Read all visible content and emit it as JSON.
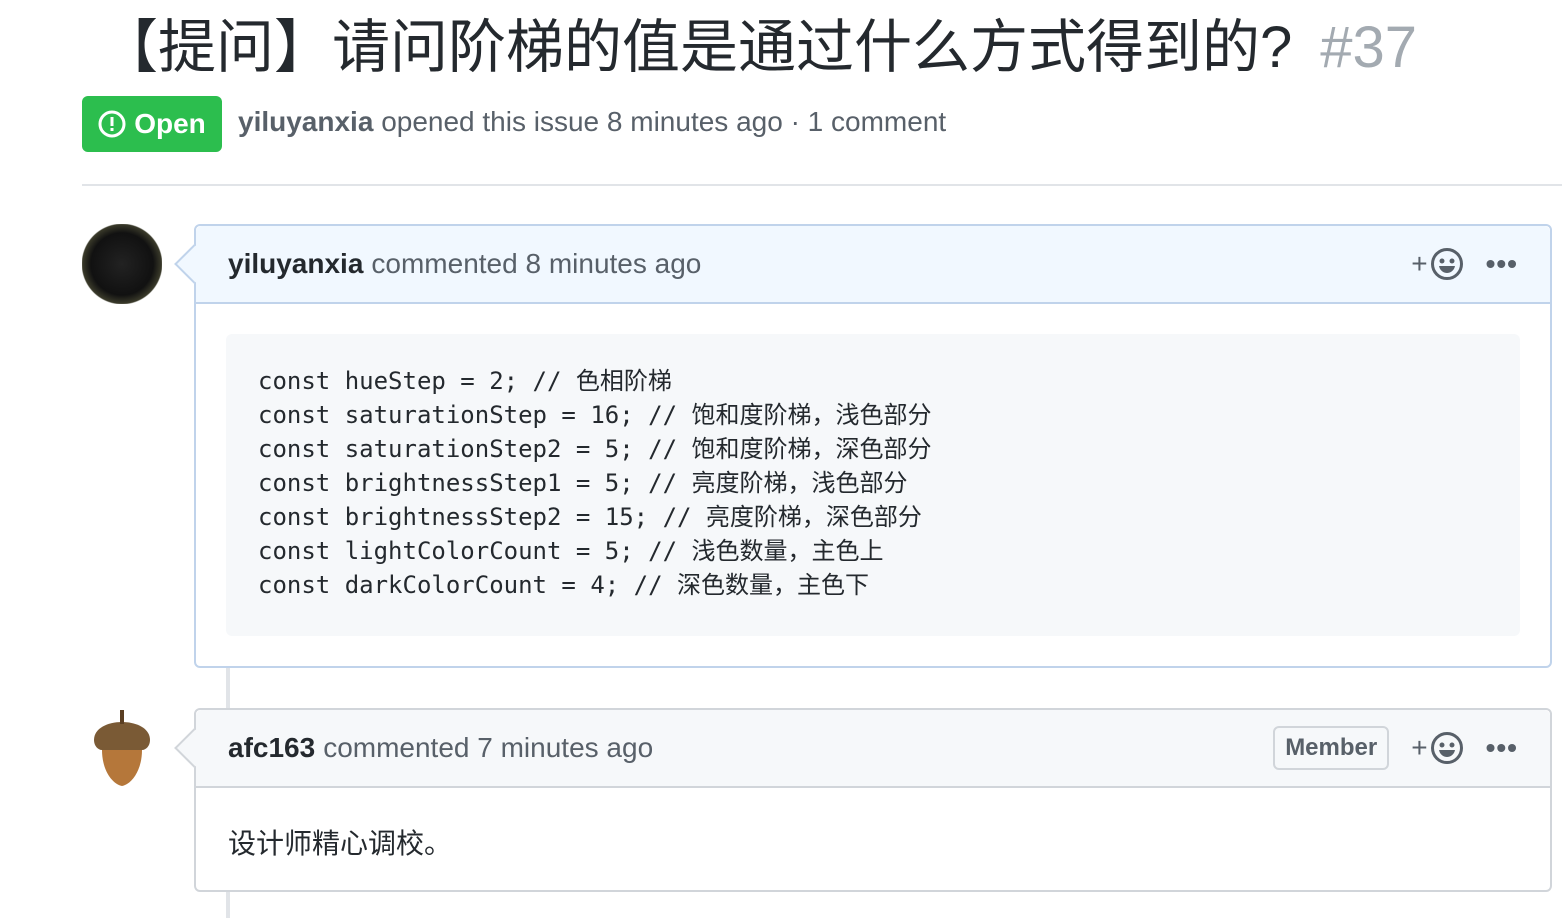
{
  "issue": {
    "title": "【提问】请问阶梯的值是通过什么方式得到的?",
    "number": "#37",
    "state": "Open",
    "author": "yiluyanxia",
    "meta_text": "opened this issue 8 minutes ago · 1 comment"
  },
  "comments": [
    {
      "author": "yiluyanxia",
      "action": "commented 8 minutes ago",
      "code": [
        "const hueStep = 2; // 色相阶梯",
        "const saturationStep = 16; // 饱和度阶梯，浅色部分",
        "const saturationStep2 = 5; // 饱和度阶梯，深色部分",
        "const brightnessStep1 = 5; // 亮度阶梯，浅色部分",
        "const brightnessStep2 = 15; // 亮度阶梯，深色部分",
        "const lightColorCount = 5; // 浅色数量，主色上",
        "const darkColorCount = 4; // 深色数量，主色下"
      ]
    },
    {
      "author": "afc163",
      "action": "commented 7 minutes ago",
      "badge": "Member",
      "body": "设计师精心调校。"
    }
  ],
  "ui": {
    "reaction_plus": "+",
    "more": "•••"
  }
}
